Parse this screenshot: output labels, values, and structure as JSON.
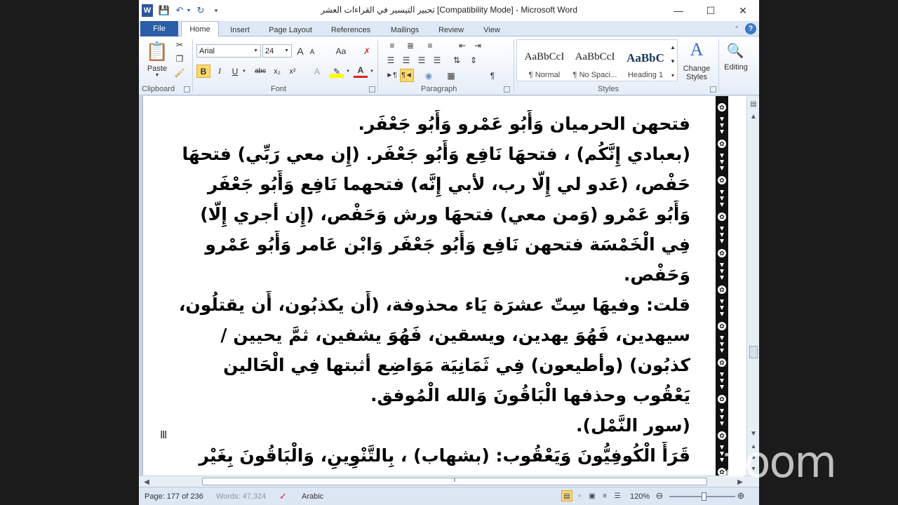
{
  "titlebar": {
    "title": "تحبير التيسير في القراءات العشر [Compatibility Mode] - Microsoft Word",
    "word_icon": "W",
    "minimize": "—",
    "maximize": "☐",
    "close": "✕"
  },
  "tabs": [
    "File",
    "Home",
    "Insert",
    "Page Layout",
    "References",
    "Mailings",
    "Review",
    "View"
  ],
  "active_tab": "Home",
  "ribbon": {
    "clipboard": {
      "paste_label": "Paste",
      "group_label": "Clipboard"
    },
    "font": {
      "font_name": "Arial",
      "font_size": "24",
      "group_label": "Font",
      "bold": "B",
      "italic": "I",
      "underline": "U",
      "strike": "abc",
      "subscript": "x₂",
      "superscript": "x²",
      "grow": "A",
      "shrink": "A",
      "change_case": "Aa"
    },
    "paragraph": {
      "group_label": "Paragraph",
      "pilcrow": "¶"
    },
    "styles": {
      "group_label": "Styles",
      "items": [
        {
          "sample": "AaBbCcI",
          "name": "¶ Normal"
        },
        {
          "sample": "AaBbCcI",
          "name": "¶ No Spaci..."
        },
        {
          "sample": "AaBbC",
          "name": "Heading 1"
        }
      ],
      "change_styles": "Change Styles"
    },
    "editing": {
      "label": "Editing"
    }
  },
  "document": {
    "lines": [
      "فتحهن الحرميان وَأَبُو عَمْرو وَأَبُو جَعْفَر.",
      "(بعبادي إِنَّكُم) ، فتحهَا نَافِع وَأَبُو جَعْفَر. (إِن معي رَبِّي) فتحهَا",
      "حَفْص، (عَدو لي إِلَّا رب، لأبي إِنَّه) فتحهما نَافِع وَأَبُو جَعْفَر",
      "وَأَبُو عَمْرو (وَمن معي) فتحهَا ورش وَحَفْص، (إِن أجري إِلَّا)",
      "فِي الْخَمْسَة فتحهن نَافِع وَأَبُو جَعْفَر وَابْن عَامر وَأَبُو عَمْرو",
      "وَحَفْص.",
      "قلت: وفيهَا سِتّ عشرَة يَاء محذوفة، (أَن يكذبُون، أَن يقتلُون،",
      "سيهدين، فَهُوَ يهدين، ويسقين، فَهُوَ يشفين، ثمَّ يحيين /",
      "كذبُون) (وأطيعون) فِي ثَمَانِيَة مَوَاضِع أثبتها فِي الْحَالين",
      "يَعْقُوب وحذفها الْبَاقُونَ وَالله الْمُوفق.",
      "(سور النَّمْل).",
      "قَرَأَ الْكُوفِيُّونَ وَيَعْقُوب: (بشهاب) ، بِالتَّنْوِينِ، وَالْبَاقُونَ بِغَيْر"
    ]
  },
  "statusbar": {
    "page": "Page: 177 of 236",
    "words": "Words: 47,324",
    "language": "Arabic",
    "zoom": "120%",
    "zoom_level_percent": 120
  },
  "watermark": "zoom",
  "colors": {
    "file_tab": "#2a5ea8",
    "highlight": "#fbd96b",
    "border_strip": "#111111"
  }
}
